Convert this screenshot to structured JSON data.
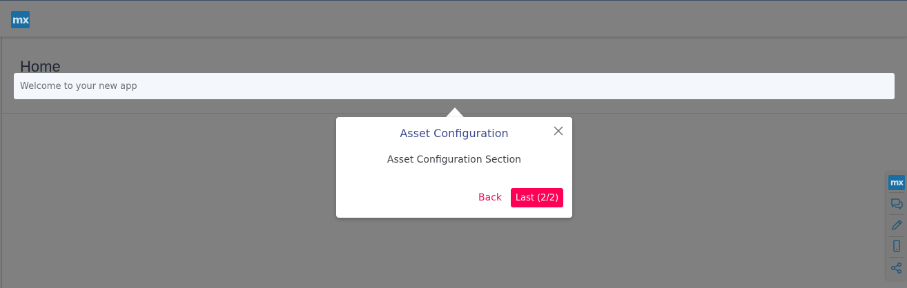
{
  "app": {
    "logo_text": "mx"
  },
  "page": {
    "title": "Home",
    "welcome_text": "Welcome to your new app"
  },
  "popover": {
    "title": "Asset Configuration",
    "body": "Asset Configuration Section",
    "back_label": "Back",
    "last_label": "Last (2/2)"
  },
  "side_toolbar": {
    "logo_text": "mx",
    "icons": [
      "feedback-icon",
      "edit-pencil-icon",
      "mobile-device-icon",
      "share-icon"
    ]
  },
  "colors": {
    "overlay": "#808080",
    "brand_blue": "#1b6ea3",
    "accent_pink": "#ff0057",
    "popover_title": "#3a4a8c"
  }
}
